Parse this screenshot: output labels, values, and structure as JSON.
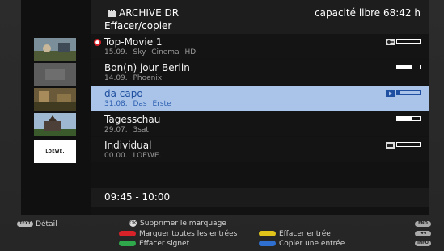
{
  "header": {
    "title": "ARCHIVE DR",
    "subtitle": "Effacer/copier",
    "capacity": "capacité libre 68:42 h"
  },
  "recordings": [
    {
      "title": "Top-Movie 1",
      "meta": "15.09. Sky Cinema HD",
      "progress": 0.0,
      "status_icon": "key-icon",
      "recording_indicator": true,
      "selected": false
    },
    {
      "title": "Bon(n) jour Berlin",
      "meta": "14.09. Phoenix",
      "progress": 0.65,
      "status_icon": "",
      "recording_indicator": false,
      "selected": false
    },
    {
      "title": "da capo",
      "meta": "31.08. Das Erste",
      "progress": 0.15,
      "status_icon": "play-icon",
      "recording_indicator": false,
      "selected": true
    },
    {
      "title": "Tagesschau",
      "meta": "29.07. 3sat",
      "progress": 0.65,
      "status_icon": "",
      "recording_indicator": false,
      "selected": false
    },
    {
      "title": "Individual",
      "meta": "00.00. LOEWE.",
      "progress": 0.0,
      "status_icon": "folder-icon",
      "recording_indicator": false,
      "selected": false
    }
  ],
  "thumbnail_logo": "LOEWE.",
  "time_range": "09:45 - 10:00",
  "footer": {
    "text_key": "TEXT",
    "detail": "Détail",
    "ok_key": "OK",
    "remove_mark": "Supprimer le marquage",
    "red": "Marquer toutes les entrées",
    "green": "Effacer signet",
    "yellow": "Effacer entrée",
    "blue": "Copier une entrée",
    "end_key": "END",
    "rew_key": "◄◄",
    "info_key": "INFO"
  },
  "colors": {
    "selection": "#a9c4e8",
    "red": "#d8222a",
    "green": "#2ea84a",
    "yellow": "#e0c21a",
    "blue": "#2f6fd0"
  }
}
